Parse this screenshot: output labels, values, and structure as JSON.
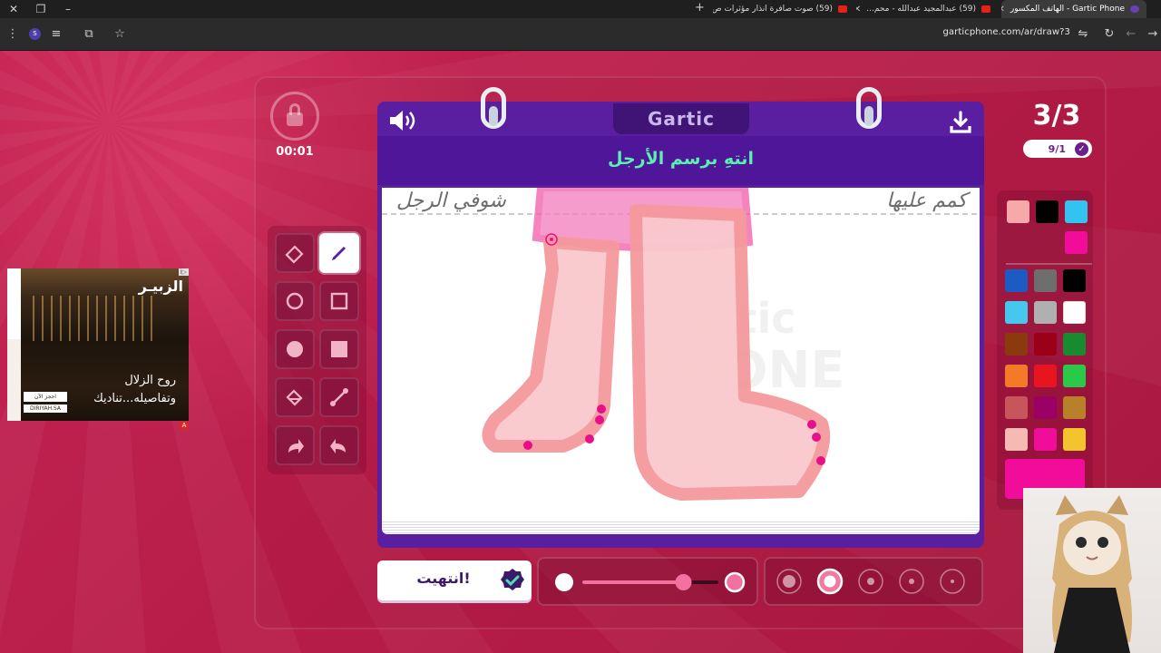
{
  "browser": {
    "tabs": [
      {
        "title": "Gartic Phone - الهاتف المكسور",
        "active": true
      },
      {
        "title": "(59) عبدالمجيد عبدالله - محم...",
        "active": false
      },
      {
        "title": "(59) صوت صافرة انذار مؤثرات ص...",
        "active": false
      }
    ],
    "new_tab_label": "+",
    "url": "garticphone.com/ar/draw?3",
    "profile_badge": "S"
  },
  "game": {
    "timer": "00:01",
    "round": "3/3",
    "done_count": "9/1",
    "logo": "Gartic",
    "prompt": "انتهِ برسم الأرجل",
    "canvas_handwriting_right": "كمم عليها",
    "canvas_handwriting_left": "شوفي الرجل",
    "done_button_label": "انتهيت!",
    "selected_tool": "pen",
    "tools": [
      "eraser",
      "pen",
      "ellipse-outline",
      "rectangle-outline",
      "ellipse-filled",
      "rectangle-filled",
      "bucket",
      "line",
      "redo",
      "undo"
    ],
    "colors_recent": [
      "#F7A8A8",
      "#000000",
      "#33C3F0",
      "#F20C9A"
    ],
    "colors_palette": [
      "#1D5BC4",
      "#6E6E6E",
      "#000000",
      "#45C7F0",
      "#B0B0B0",
      "#FFFFFF",
      "#8B3A0E",
      "#9B0016",
      "#188A30",
      "#F47A28",
      "#E8151F",
      "#2BC94A",
      "#C8555C",
      "#9B0066",
      "#B78029",
      "#F7B9B4",
      "#F20C9A",
      "#F4C42C"
    ],
    "current_color": "#F20C9A",
    "opacity_level": 0.75,
    "brush_sizes": 5,
    "selected_brush_size": 2
  },
  "ad": {
    "brand": "الزبيـر",
    "headline_1": "روح الزلال",
    "headline_2": "وتفاصيله...تناديك",
    "cta": "احجز الآن",
    "site": "DIRIYAH.SA",
    "ad_tag": "i▷",
    "badge": "A"
  }
}
